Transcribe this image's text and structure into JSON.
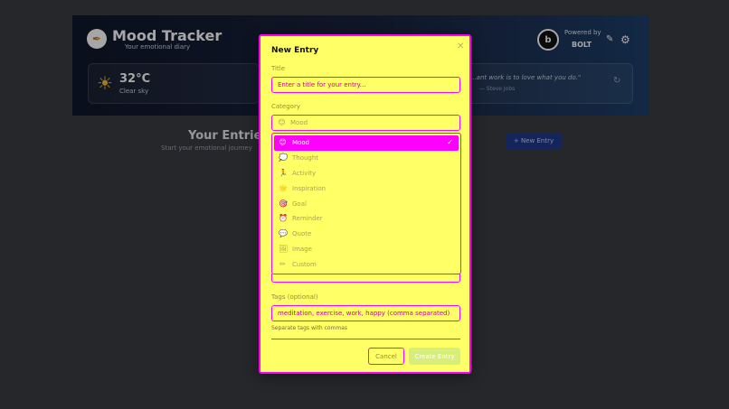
{
  "app": {
    "title": "Mood Tracker",
    "subtitle": "Your emotional diary",
    "powered_by": "Powered by",
    "bolt_brand": "BOLT",
    "bolt_glyph": "b"
  },
  "weather": {
    "temperature": "32°C",
    "condition": "Clear sky"
  },
  "quote": {
    "text": "...ant work is to love what you do.\"",
    "author": "— Steve Jobs"
  },
  "entries": {
    "title": "Your Entries",
    "subtitle": "Start your emotional journey",
    "new_entry_label": "+ New Entry"
  },
  "modal": {
    "title": "New Entry",
    "title_label": "Title",
    "title_placeholder": "Enter a title for your entry...",
    "category_label": "Category",
    "category_selected": "Mood",
    "category_selected_emoji": "😊",
    "categories": [
      {
        "emoji": "😊",
        "label": "Mood",
        "selected": true
      },
      {
        "emoji": "💭",
        "label": "Thought"
      },
      {
        "emoji": "🏃",
        "label": "Activity"
      },
      {
        "emoji": "🌟",
        "label": "Inspiration"
      },
      {
        "emoji": "🎯",
        "label": "Goal"
      },
      {
        "emoji": "⏰",
        "label": "Reminder"
      },
      {
        "emoji": "💬",
        "label": "Quote"
      },
      {
        "emoji": "🖼",
        "label": "Image"
      },
      {
        "emoji": "✏",
        "label": "Custom"
      }
    ],
    "tags_label": "Tags (optional)",
    "tags_placeholder": "meditation, exercise, work, happy (comma separated)",
    "tags_hint": "Separate tags with commas",
    "cancel_label": "Cancel",
    "create_label": "Create Entry"
  },
  "colors": {
    "modal_bg": "#ffff66",
    "accent": "#ff00ff",
    "header_start": "#0f172a",
    "header_end": "#1d3f6b"
  },
  "icons": {
    "logo": "feather-icon",
    "close": "close-icon",
    "check": "check-icon",
    "weather": "sun-icon",
    "settings": "gear-icon",
    "edit": "edit-icon",
    "refresh": "refresh-icon"
  }
}
